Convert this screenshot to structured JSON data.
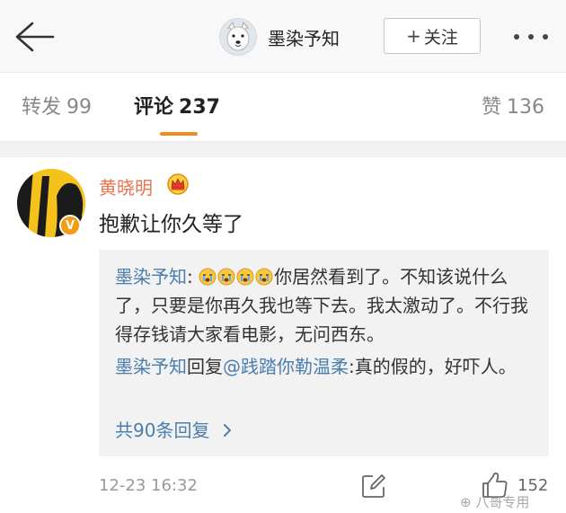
{
  "header": {
    "user_name": "墨染予知",
    "follow_label": "关注",
    "back_icon": "arrow-left-icon",
    "more_icon": "more-dots-icon"
  },
  "tabs": [
    {
      "label": "转发",
      "count": "99",
      "active": false
    },
    {
      "label": "评论",
      "count": "237",
      "active": true
    },
    {
      "label": "赞",
      "count": "136",
      "active": false
    }
  ],
  "comment": {
    "author": "黄晓明",
    "text": "抱歉让你久等了",
    "time": "12-23 16:32",
    "like_count": "152",
    "verified_badge": "V"
  },
  "replies": {
    "reply1": {
      "author": "墨染予知",
      "text": "你居然看到了。不知该说什么了，只要是你再久我也等下去。我太激动了。不行我得存钱请大家看电影，无问西东。"
    },
    "reply2": {
      "author": "墨染予知",
      "reply_word": "回复",
      "mention": "@践踏你勒温柔",
      "text": ":真的假的，好吓人。"
    },
    "more_label": "共90条回复"
  },
  "watermark": "八哥专用",
  "colors": {
    "accent_orange": "#f08c1f",
    "name_orange": "#eb7350",
    "link_blue": "#4a7eb0"
  }
}
